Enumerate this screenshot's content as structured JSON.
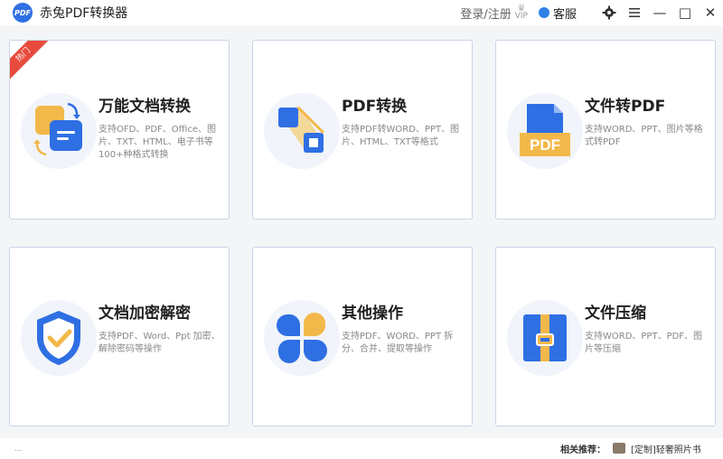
{
  "app": {
    "logo_text": "PDF",
    "title": "赤兔PDF转换器"
  },
  "titlebar": {
    "login": "登录/注册",
    "vip": "VIP",
    "service": "客服",
    "settings_icon": "gear-icon",
    "menu_icon": "hamburger-icon",
    "minimize": "—",
    "maximize": "□",
    "close": "✕"
  },
  "cards": [
    {
      "title": "万能文档转换",
      "desc": "支持OFD、PDF、Office、图片、TXT、HTML、电子书等100+种格式转换",
      "badge": "热门",
      "icon": "universal-convert-icon"
    },
    {
      "title": "PDF转换",
      "desc": "支持PDF转WORD、PPT、图片、HTML、TXT等格式",
      "icon": "pdf-convert-icon"
    },
    {
      "title": "文件转PDF",
      "desc": "支持WORD、PPT、图片等格式转PDF",
      "icon": "file-to-pdf-icon",
      "icon_text": "PDF"
    },
    {
      "title": "文档加密解密",
      "desc": "支持PDF、Word、Ppt 加密、解除密码等操作",
      "icon": "shield-check-icon"
    },
    {
      "title": "其他操作",
      "desc": "支持PDF、WORD、PPT 拆分、合并、提取等操作",
      "icon": "petals-icon"
    },
    {
      "title": "文件压缩",
      "desc": "支持WORD、PPT、PDF、图片等压缩",
      "icon": "zip-icon"
    }
  ],
  "bottom": {
    "dots": "...",
    "label": "相关推荐：",
    "link": "[定制]轻奢照片书"
  },
  "colors": {
    "accent": "#2f6fe4",
    "yellow": "#f3b84a",
    "hot": "#e84b3c",
    "border": "#c9d3e6"
  }
}
